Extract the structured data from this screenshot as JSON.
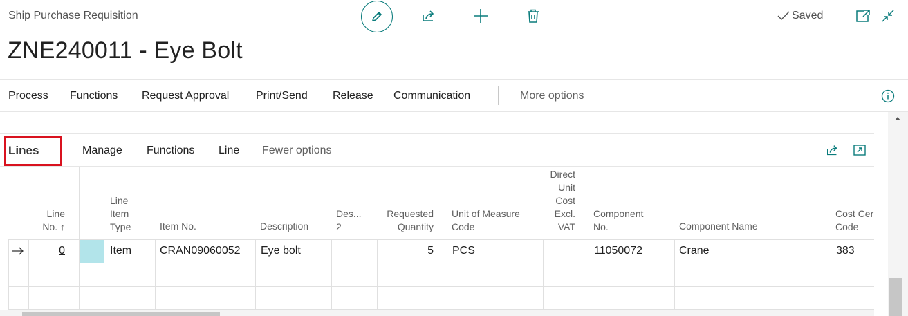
{
  "header": {
    "caption": "Ship Purchase Requisition",
    "title": "ZNE240011 - Eye Bolt",
    "saved_label": "Saved",
    "icons": [
      "edit-icon",
      "share-icon",
      "add-icon",
      "delete-icon",
      "open-new-window-icon",
      "collapse-icon"
    ]
  },
  "actions": [
    "Process",
    "Functions",
    "Request Approval",
    "Print/Send",
    "Release",
    "Communication"
  ],
  "more_options": "More options",
  "lines_part": {
    "title": "Lines",
    "actions": [
      "Manage",
      "Functions",
      "Line"
    ],
    "fewer_options": "Fewer options"
  },
  "columns": {
    "line_no": [
      "Line",
      "No. ↑"
    ],
    "line_item_type": [
      "Line",
      "Item",
      "Type"
    ],
    "item_no": "Item No.",
    "description": "Description",
    "description_2": [
      "Des...",
      "2"
    ],
    "requested_quantity": [
      "Requested",
      "Quantity"
    ],
    "unit_of_measure_code": [
      "Unit of Measure",
      "Code"
    ],
    "direct_unit_cost": [
      "Direct",
      "Unit",
      "Cost",
      "Excl.",
      "VAT"
    ],
    "component_no": [
      "Component",
      "No."
    ],
    "component_name": "Component Name",
    "cost_center_code": [
      "Cost Cer",
      "Code"
    ]
  },
  "rows": [
    {
      "line_no": "0",
      "line_item_type": "Item",
      "item_no": "CRAN09060052",
      "description": "Eye bolt",
      "description_2": "",
      "requested_quantity": "5",
      "unit_of_measure_code": "PCS",
      "direct_unit_cost": "",
      "component_no": "11050072",
      "component_name": "Crane",
      "cost_center_code": "383"
    }
  ],
  "colors": {
    "accent": "#0a7c7c",
    "highlight_border": "#d9121f",
    "selected_cell": "#b2e4ea"
  }
}
